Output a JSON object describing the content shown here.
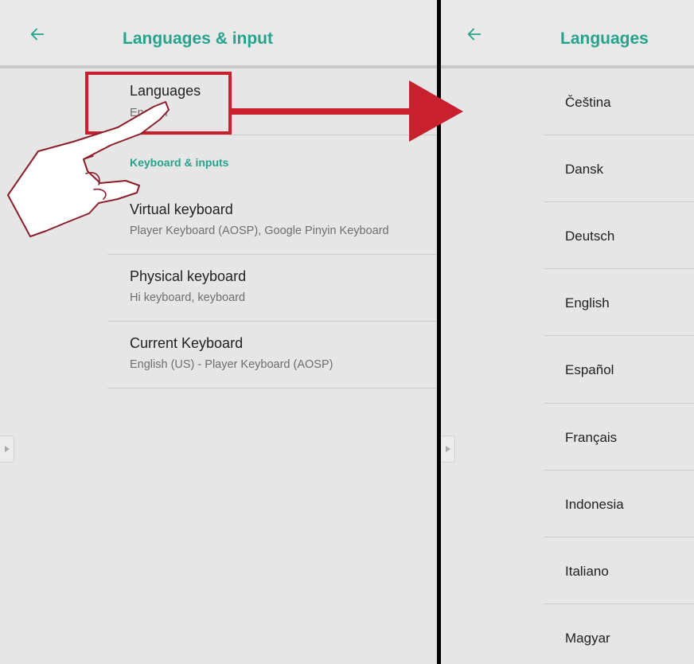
{
  "left_screen": {
    "title": "Languages & input",
    "languages_item": {
      "title": "Languages",
      "subtitle": "English"
    },
    "section_header": "Keyboard & inputs",
    "items": [
      {
        "title": "Virtual keyboard",
        "subtitle": "Player Keyboard (AOSP), Google Pinyin Keyboard"
      },
      {
        "title": "Physical keyboard",
        "subtitle": "Hi keyboard, keyboard"
      },
      {
        "title": "Current Keyboard",
        "subtitle": "English (US) - Player Keyboard (AOSP)"
      }
    ]
  },
  "right_screen": {
    "title": "Languages",
    "languages": [
      "Čeština",
      "Dansk",
      "Deutsch",
      "English",
      "Español",
      "Français",
      "Indonesia",
      "Italiano",
      "Magyar"
    ]
  },
  "icons": {
    "back": "arrow-left-icon",
    "side_handle": "triangle-right-icon",
    "pointer": "hand-pointer-icon",
    "highlight": "red-rectangle-highlight",
    "arrow": "red-right-arrow"
  },
  "colors": {
    "accent": "#26a38d",
    "highlight": "#c8202f",
    "panel_background": "#e6e6e6",
    "divider": "#000000"
  }
}
